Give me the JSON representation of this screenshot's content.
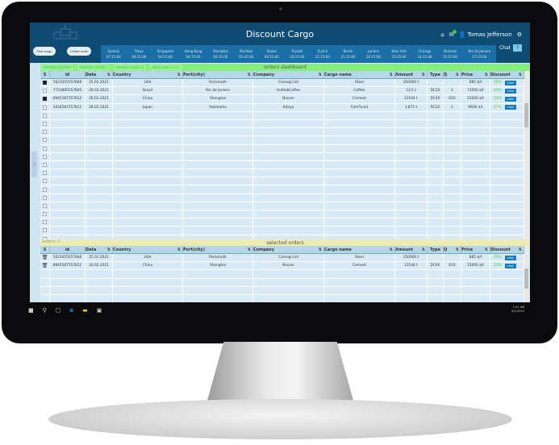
{
  "app": {
    "title": "Discount Cargo",
    "buttons": {
      "find": "Find cargo",
      "create": "Create order"
    },
    "user": "Tomas Jefferson",
    "mail_badge": "1",
    "chat_label": "Chat",
    "chat_count": "3",
    "cities": [
      {
        "name": "Sydney",
        "time": "07:15:00"
      },
      {
        "name": "Tokyo",
        "time": "06:15:00"
      },
      {
        "name": "Singapore",
        "time": "04:15:00"
      },
      {
        "name": "Hong Kong",
        "time": "04:15:00"
      },
      {
        "name": "Shanghai",
        "time": "04:15:00"
      },
      {
        "name": "Mumbai",
        "time": "01:45:00"
      },
      {
        "name": "Dubai",
        "time": "00:15:00"
      },
      {
        "name": "Riyadh",
        "time": "23:15:00"
      },
      {
        "name": "Zurich",
        "time": "21:15:00"
      },
      {
        "name": "Berlin",
        "time": "21:15:00"
      },
      {
        "name": "London",
        "time": "20:15:00"
      },
      {
        "name": "New York",
        "time": "15:15:00"
      },
      {
        "name": "Chicago",
        "time": "14:15:00"
      },
      {
        "name": "Panama",
        "time": "15:15:00"
      },
      {
        "name": "Rio de Janeiro",
        "time": "17:15:00"
      }
    ]
  },
  "dashboard": {
    "title": "orders dashboard",
    "stats": [
      "orders: 1278",
      "month: +83",
      "week: +29",
      "day: +4"
    ]
  },
  "columns": [
    "S",
    "id",
    "Data",
    "Country",
    "Port(city)",
    "Company",
    "Cargo name",
    "Amount",
    "Type",
    "Q",
    "Price",
    "Discount"
  ],
  "sortable": [
    false,
    false,
    true,
    true,
    true,
    true,
    true,
    true,
    false,
    true,
    true,
    true
  ],
  "view_label": "view",
  "orders": [
    {
      "checked": true,
      "id": "5623455557846",
      "date": "25.02.2021",
      "country": "USA",
      "port": "Portsmuth",
      "company": "Carnegi Ltd",
      "cargo": "Steel",
      "amount": "350000 t",
      "type": "",
      "q": "",
      "price": "885 $/t",
      "discount": "35%"
    },
    {
      "checked": false,
      "id": "7723895557845",
      "date": "26.02.2021",
      "country": "Brazil",
      "port": "Rio de Janeiro",
      "company": "AraRobCoffee",
      "cargo": "Coffee",
      "amount": "13,5 t",
      "type": "DC20",
      "q": "1",
      "price": "73500 $/t",
      "discount": "64%"
    },
    {
      "checked": true,
      "id": "8945587557812",
      "date": "26.02.2021",
      "country": "China",
      "port": "Shanghai",
      "company": "Niosan",
      "cargo": "Cement",
      "amount": "23544 t",
      "type": "DC40",
      "q": "610",
      "price": "15000 $/t",
      "discount": "12%"
    },
    {
      "checked": false,
      "id": "3434587557811",
      "date": "28.02.2021",
      "country": "Japan",
      "port": "Yokohama",
      "company": "Kitoyo",
      "cargo": "Fish(Tuna)",
      "amount": "1,875 t",
      "type": "RC20",
      "q": "1",
      "price": "9600 $/t",
      "discount": "27%"
    }
  ],
  "selected": {
    "title": "selected orders",
    "count": "orders: 2",
    "orders": [
      {
        "id": "5623455557846",
        "date": "25.02.2021",
        "country": "USA",
        "port": "Portsmuth",
        "company": "Carnegi Ltd",
        "cargo": "Steel",
        "amount": "350000 t",
        "type": "",
        "q": "",
        "price": "885 $/t",
        "discount": "35%"
      },
      {
        "id": "8945587557812",
        "date": "26.02.2021",
        "country": "China",
        "port": "Shanghai",
        "company": "Niosan",
        "cargo": "Cement",
        "amount": "23544 t",
        "type": "DC40",
        "q": "610",
        "price": "15000 $/t",
        "discount": "12%"
      }
    ]
  },
  "taskbar": {
    "time": "1:42 AM",
    "date": "6/1/2015"
  }
}
